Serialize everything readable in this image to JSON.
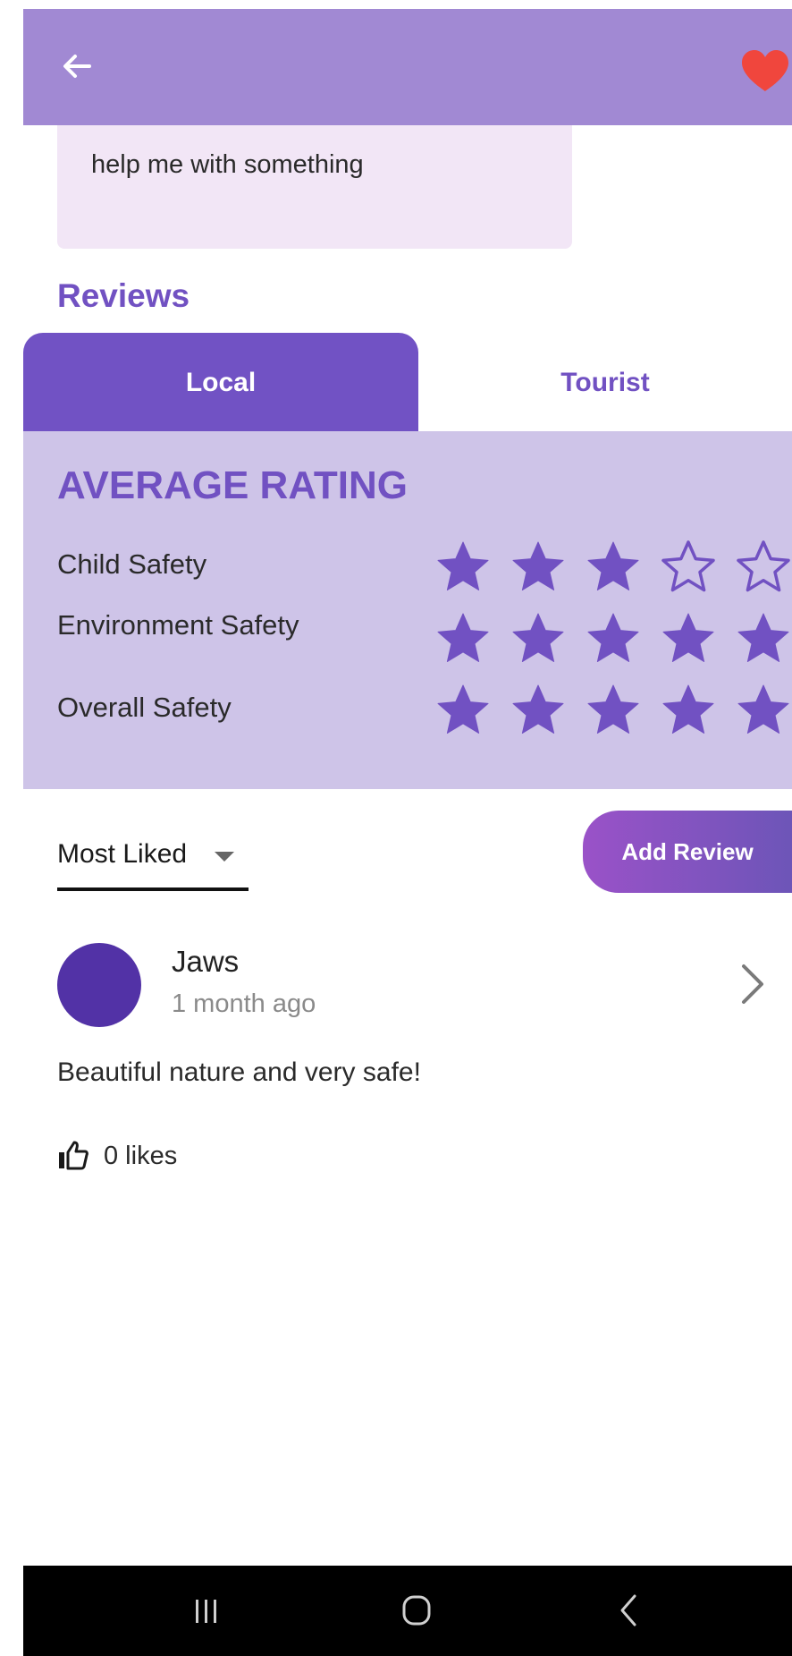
{
  "colors": {
    "app_bar": "#a189d3",
    "accent": "#7151c2",
    "tab_active": "#7152c4",
    "rating_panel": "#cec4e8",
    "desc_card": "#f2e6f6",
    "favorite": "#f0463d",
    "avatar": "#5232a6"
  },
  "header": {
    "back_icon": "arrow-left-icon",
    "favorite_icon": "heart-filled-icon"
  },
  "description": {
    "text": "help me with something"
  },
  "reviews": {
    "title": "Reviews",
    "tabs": [
      {
        "label": "Local",
        "active": true
      },
      {
        "label": "Tourist",
        "active": false
      }
    ]
  },
  "average_rating": {
    "title": "AVERAGE RATING",
    "max": 5,
    "rows": [
      {
        "label": "Child Safety",
        "value": 3
      },
      {
        "label": "Environment Safety",
        "value": 5
      },
      {
        "label": "Overall Safety",
        "value": 5
      }
    ]
  },
  "sort": {
    "selected": "Most Liked"
  },
  "add_review": {
    "label": "Add Review"
  },
  "review_list": [
    {
      "author": "Jaws",
      "time": "1 month ago",
      "text": "Beautiful nature and very safe!",
      "likes_label": "0 likes",
      "like_icon": "thumbs-up-outline-icon",
      "chevron_icon": "chevron-right-icon"
    }
  ],
  "system_nav": {
    "recents": "recent-apps-icon",
    "home": "home-icon",
    "back": "back-icon"
  }
}
